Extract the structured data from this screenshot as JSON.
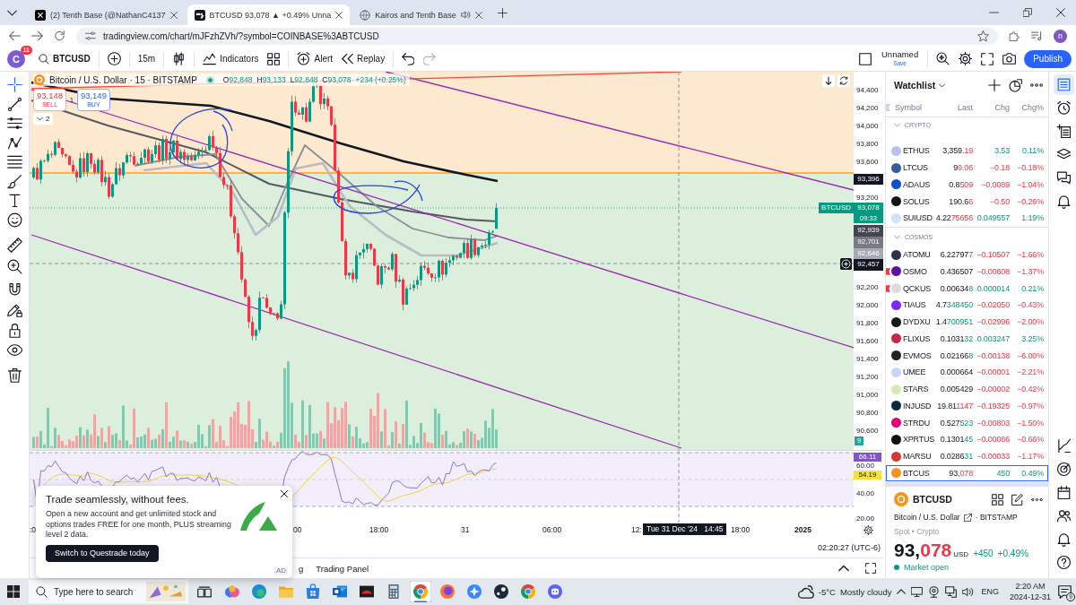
{
  "browser": {
    "tabs": [
      {
        "title": "(2) Tenth Base (@NathanC4137",
        "selected": false,
        "audio": false
      },
      {
        "title": "BTCUSD 93,078 ▲ +0.49% Unna",
        "selected": true,
        "audio": false
      },
      {
        "title": "Kairos and Tenth Base",
        "selected": false,
        "audio": true
      }
    ],
    "url": "tradingview.com/chart/mJFzhZVh/?symbol=COINBASE%3ABTCUSD",
    "profile_letter": "n"
  },
  "toolbar": {
    "avatar_letter": "C",
    "notification_count": "11",
    "symbol": "BTCUSD",
    "interval": "15m",
    "indicators": "Indicators",
    "alert": "Alert",
    "replay": "Replay",
    "redo_enabled": false,
    "layout_name": "Unnamed",
    "save": "Save",
    "publish": "Publish"
  },
  "left_toolbar": [
    {
      "selected": true
    },
    {
      "selected": false
    },
    {
      "selected": false
    },
    {
      "selected": false
    },
    {
      "selected": false
    },
    {
      "selected": false
    },
    {
      "selected": false
    },
    {
      "selected": false
    },
    {
      "selected": false
    },
    {
      "selected": false
    },
    {
      "selected": false
    },
    {
      "selected": false
    },
    {
      "selected": false
    },
    {
      "selected": false
    },
    {
      "selected": false
    }
  ],
  "chart": {
    "title": "Bitcoin / U.S. Dollar · 15 · BITSTAMP",
    "ohlc": [
      {
        "label": "O",
        "value": "92,848"
      },
      {
        "label": "H",
        "value": "93,133"
      },
      {
        "label": "L",
        "value": "92,848"
      },
      {
        "label": "C",
        "value": "93,078"
      }
    ],
    "change": "+234 (+0.25%)",
    "sell": {
      "price": "93,148",
      "label": "SELL"
    },
    "spread": "1",
    "buy": {
      "price": "93,149",
      "label": "BUY"
    },
    "collapsed_count": "2",
    "symbol_label": "BTCUSD",
    "price_ticks": [
      "94,400",
      "94,200",
      "94,000",
      "93,800",
      "93,600",
      "93,200",
      "92,200",
      "92,000",
      "91,800",
      "91,600",
      "91,400",
      "91,200",
      "91,000",
      "90,800",
      "90,600"
    ],
    "price_tags": [
      {
        "kind": "line",
        "value": "93,396",
        "color": "#131722"
      },
      {
        "kind": "last",
        "value": "93,078",
        "countdown": "09:33",
        "color": "#089981"
      },
      {
        "kind": "line",
        "value": "92,939",
        "color": "#434651"
      },
      {
        "kind": "line",
        "value": "92,701",
        "color": "#787b86"
      },
      {
        "kind": "line",
        "value": "92,646",
        "color": "#a8abb5"
      },
      {
        "kind": "crosshair",
        "value": "92,457",
        "color": "#131722"
      }
    ],
    "volume_tag": "9",
    "rsi": {
      "ticks": [
        "60.00",
        "40.00",
        "20.00"
      ],
      "tags": [
        {
          "value": "66.11",
          "color": "#7e57c2"
        },
        {
          "value": "54.19",
          "color": "#f5e33b"
        }
      ]
    },
    "time_labels": [
      {
        "text": ":0",
        "kind": "time"
      },
      {
        "text": "00",
        "kind": "time"
      },
      {
        "text": "18:00",
        "kind": "time"
      },
      {
        "text": "31",
        "kind": "time"
      },
      {
        "text": "06:00",
        "kind": "time"
      },
      {
        "text": "12:",
        "kind": "time"
      },
      {
        "text": "18:00",
        "kind": "time"
      },
      {
        "text": "2025",
        "kind": "year"
      }
    ],
    "crosshair_time": "Tue 31 Dec '24   14:45"
  },
  "bottom_panel": {
    "clock": "02:20:27 (UTC-6)",
    "tabs": [
      "g",
      "Trading Panel"
    ]
  },
  "ad": {
    "title": "Trade seamlessly, without fees.",
    "body": "Open a new account and get unlimited stock and options trades FREE for one month, PLUS streaming level 2 data.",
    "button": "Switch to Questrade today",
    "badge": "AD"
  },
  "watchlist": {
    "title": "Watchlist",
    "columns": [
      "Symbol",
      "Last",
      "Chg",
      "Chg%"
    ],
    "sections": [
      {
        "name": "CRYPTO",
        "expanded": true,
        "rows": [
          {
            "symbol": "ETHUS",
            "color": "#b8c2f0",
            "last": "3,359.",
            "last_tail": "19",
            "tail_rising": false,
            "change": "3.53",
            "change_pct": "0.11%",
            "rising": true,
            "flagged": false,
            "selected": false
          },
          {
            "symbol": "LTCUS",
            "color": "#345d9d",
            "last": "9",
            "last_tail": "9.06",
            "tail_rising": false,
            "change": "−0.18",
            "change_pct": "−0.18%",
            "rising": false,
            "flagged": false,
            "selected": false
          },
          {
            "symbol": "ADAUS",
            "color": "#0d4fd1",
            "last": "0.8",
            "last_tail": "509",
            "tail_rising": false,
            "change": "−0.0089",
            "change_pct": "−1.04%",
            "rising": false,
            "flagged": false,
            "selected": false
          },
          {
            "symbol": "SOLUS",
            "color": "#141414",
            "last": "190.6",
            "last_tail": "6",
            "tail_rising": false,
            "change": "−0.50",
            "change_pct": "−0.26%",
            "rising": false,
            "flagged": false,
            "selected": false
          },
          {
            "symbol": "SUIUSD",
            "color": "#cde4fb",
            "last": "4.22",
            "last_tail": "75656",
            "tail_rising": false,
            "change": "0.049557",
            "change_pct": "1.19%",
            "rising": true,
            "flagged": false,
            "selected": false
          }
        ]
      },
      {
        "name": "COSMOS",
        "expanded": true,
        "rows": [
          {
            "symbol": "ATOMU",
            "color": "#2e3148",
            "last": "6.22797",
            "last_tail": "7",
            "tail_rising": false,
            "change": "−0.10507",
            "change_pct": "−1.66%",
            "rising": false,
            "flagged": false,
            "selected": false
          },
          {
            "symbol": "OSMO",
            "color": "#5e12a0",
            "last": "0.436507",
            "change": "−0.00608",
            "change_pct": "−1.37%",
            "rising": false,
            "flagged": true,
            "selected": false
          },
          {
            "symbol": "QCKUS",
            "color": "#dcdcdc",
            "last": "0.00634",
            "last_tail": "8",
            "tail_rising": true,
            "change": "0.000014",
            "change_pct": "0.21%",
            "rising": true,
            "flagged": true,
            "selected": false
          },
          {
            "symbol": "TIAUS",
            "color": "#7b2bf9",
            "last": "4.7",
            "last_tail": "348450",
            "tail_rising": true,
            "change": "−0.02050",
            "change_pct": "−0.43%",
            "rising": false,
            "flagged": false,
            "selected": false
          },
          {
            "symbol": "DYDXU",
            "color": "#181818",
            "last": "1.4",
            "last_tail": "700951",
            "tail_rising": true,
            "change": "−0.02996",
            "change_pct": "−2.00%",
            "rising": false,
            "flagged": false,
            "selected": false
          },
          {
            "symbol": "FLIXUS",
            "color": "#c6284c",
            "last": "0.1031",
            "last_tail": "32",
            "tail_rising": true,
            "change": "0.003247",
            "change_pct": "3.25%",
            "rising": true,
            "flagged": false,
            "selected": false
          },
          {
            "symbol": "EVMOS",
            "color": "#222222",
            "last": "0.02166",
            "last_tail": "8",
            "tail_rising": true,
            "change": "−0.00138",
            "change_pct": "−6.00%",
            "rising": false,
            "flagged": false,
            "selected": false
          },
          {
            "symbol": "UMEE",
            "color": "#c8d4f8",
            "last": "0.000664",
            "change": "−0.00001",
            "change_pct": "−2.21%",
            "rising": false,
            "flagged": false,
            "selected": false
          },
          {
            "symbol": "STARS",
            "color": "#d9e8b8",
            "last": "0.005429",
            "change": "−0.00002",
            "change_pct": "−0.42%",
            "rising": false,
            "flagged": false,
            "selected": false
          },
          {
            "symbol": "INJUSD",
            "color": "#0b2a3f",
            "last": "19.81",
            "last_tail": "1147",
            "tail_rising": false,
            "change": "−0.19325",
            "change_pct": "−0.97%",
            "rising": false,
            "flagged": false,
            "selected": false
          },
          {
            "symbol": "STRDU",
            "color": "#e6007a",
            "last": "0.527",
            "last_tail": "523",
            "tail_rising": true,
            "change": "−0.00803",
            "change_pct": "−1.50%",
            "rising": false,
            "flagged": false,
            "selected": false
          },
          {
            "symbol": "XPRTUS",
            "color": "#111111",
            "last": "0.1301",
            "last_tail": "45",
            "tail_rising": true,
            "change": "−0.00086",
            "change_pct": "−0.66%",
            "rising": false,
            "flagged": false,
            "selected": false
          },
          {
            "symbol": "MARSU",
            "color": "#d23a3a",
            "last": "0.0286",
            "last_tail": "31",
            "tail_rising": true,
            "change": "−0.00033",
            "change_pct": "−1.17%",
            "rising": false,
            "flagged": false,
            "selected": false
          },
          {
            "symbol": "BTCUS",
            "color": "#f7931a",
            "last": "93,",
            "last_tail": "078",
            "tail_rising": false,
            "change": "450",
            "change_pct": "0.49%",
            "rising": true,
            "flagged": false,
            "selected": true
          }
        ]
      }
    ]
  },
  "symbol_details": {
    "symbol": "BTCUSD",
    "name": "Bitcoin / U.S. Dollar",
    "exchange": "· BITSTAMP",
    "type": "Spot • Crypto",
    "price": "93,",
    "price_tail": "078",
    "tail_rising": false,
    "currency": "USD",
    "change": "+450",
    "change_pct": "+0.49%",
    "rising": true,
    "status": "Market open"
  },
  "right_toolbar": [
    {
      "selected": true
    },
    {
      "selected": false
    },
    {
      "selected": false
    },
    {
      "selected": false
    },
    {
      "selected": false
    },
    {
      "selected": false
    },
    {
      "selected": false
    },
    {
      "selected": false
    },
    {
      "selected": false
    },
    {
      "selected": false
    },
    {
      "selected": false
    },
    {
      "selected": false
    }
  ],
  "taskbar": {
    "search_placeholder": "Type here to search",
    "apps": [
      {
        "selected": false
      },
      {
        "selected": false
      },
      {
        "selected": false
      },
      {
        "selected": false
      },
      {
        "selected": false
      },
      {
        "selected": false
      },
      {
        "selected": false
      },
      {
        "selected": true
      },
      {
        "selected": false
      },
      {
        "selected": false
      },
      {
        "selected": false
      },
      {
        "selected": false
      },
      {
        "selected": false
      }
    ],
    "temperature": "-5°C",
    "weather": "Mostly cloudy",
    "language": "ENG",
    "time": "2:20 AM",
    "date": "2024-12-31",
    "notifications": "9"
  }
}
